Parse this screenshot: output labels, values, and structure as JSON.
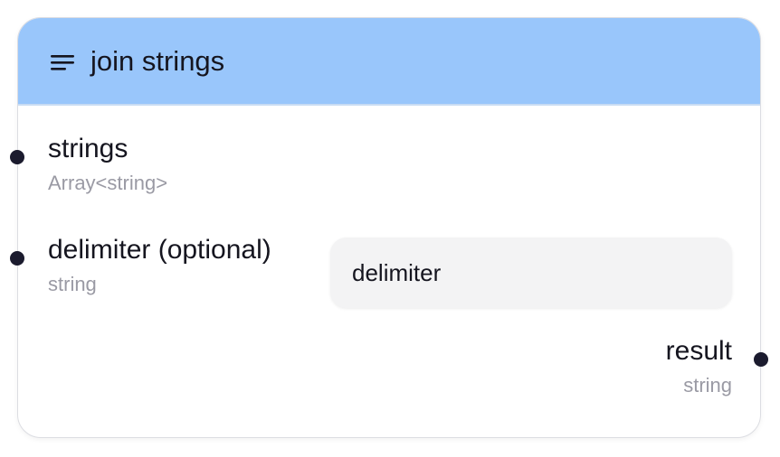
{
  "node": {
    "title": "join strings",
    "inputs": [
      {
        "label": "strings",
        "type": "Array<string>"
      },
      {
        "label": "delimiter (optional)",
        "type": "string",
        "field_placeholder": "delimiter",
        "field_value": ""
      }
    ],
    "outputs": [
      {
        "label": "result",
        "type": "string"
      }
    ]
  },
  "colors": {
    "header": "#99c6fb",
    "handle": "#1b1b2e",
    "type_text": "#9a9aa4",
    "input_bg": "#f3f3f4"
  },
  "icons": {
    "header_icon": "menu-lines-icon"
  }
}
